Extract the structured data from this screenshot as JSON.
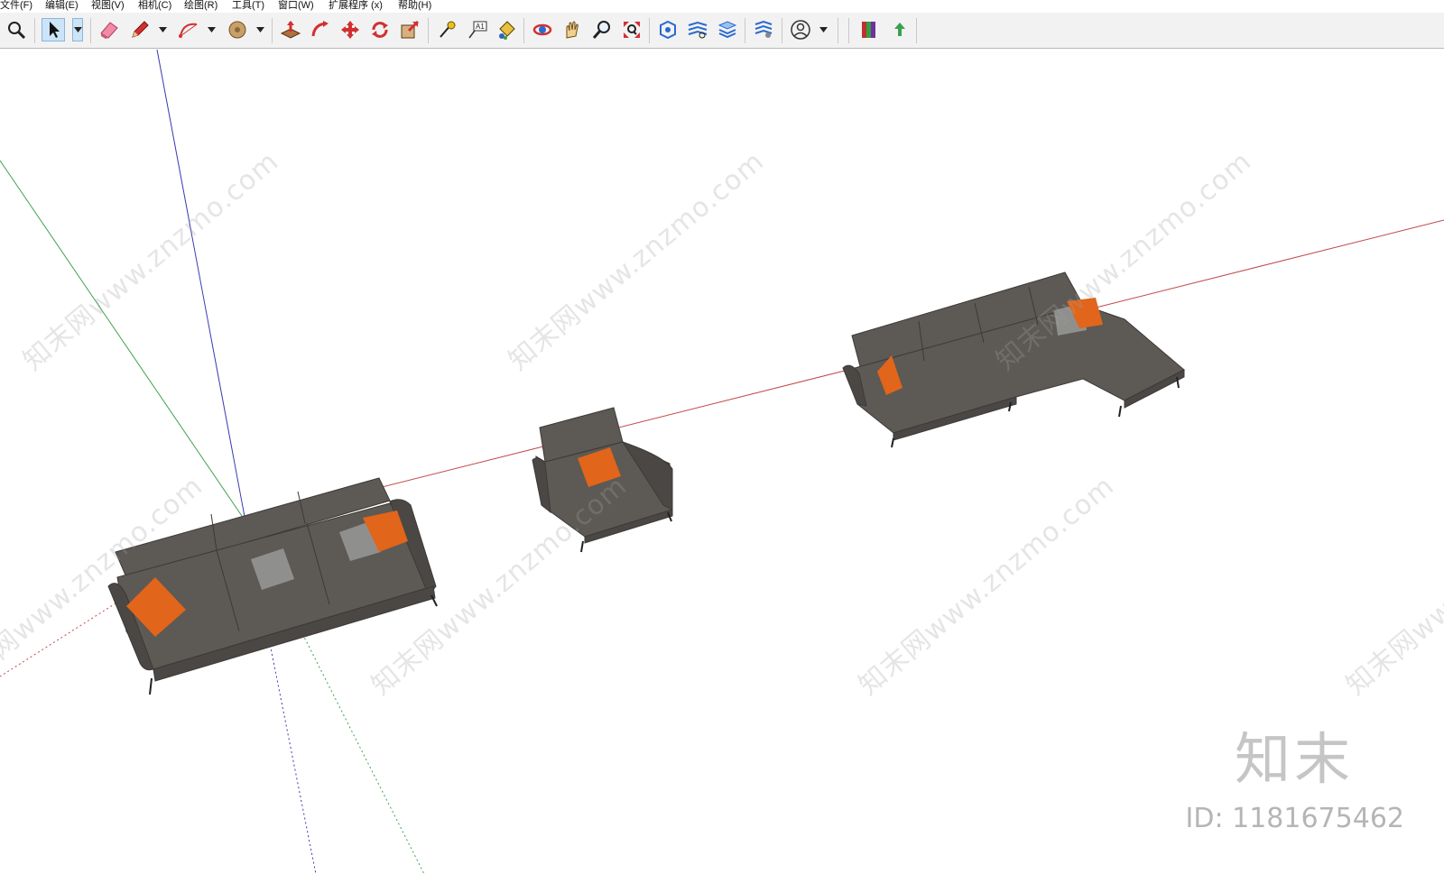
{
  "menu": [
    {
      "label": "文件(F)"
    },
    {
      "label": "编辑(E)"
    },
    {
      "label": "视图(V)"
    },
    {
      "label": "相机(C)"
    },
    {
      "label": "绘图(R)"
    },
    {
      "label": "工具(T)"
    },
    {
      "label": "窗口(W)"
    },
    {
      "label": "扩展程序 (x)"
    },
    {
      "label": "帮助(H)"
    }
  ],
  "toolbar": {
    "tools": [
      {
        "icon": "zoom-icon"
      },
      {
        "icon": "select-arrow-icon",
        "active": true
      },
      {
        "icon": "eraser-icon"
      },
      {
        "icon": "pencil-icon"
      },
      {
        "icon": "arc-icon"
      },
      {
        "icon": "shape-icon"
      },
      {
        "icon": "push-pull-icon"
      },
      {
        "icon": "follow-me-icon"
      },
      {
        "icon": "move-icon"
      },
      {
        "icon": "rotate-icon"
      },
      {
        "icon": "scale-icon"
      },
      {
        "icon": "tape-measure-icon"
      },
      {
        "icon": "text-icon",
        "text": "A1"
      },
      {
        "icon": "paint-bucket-icon"
      },
      {
        "icon": "orbit-icon"
      },
      {
        "icon": "pan-icon"
      },
      {
        "icon": "zoom-window-icon"
      },
      {
        "icon": "zoom-extents-icon"
      },
      {
        "icon": "warehouse-icon"
      },
      {
        "icon": "extension-icon"
      },
      {
        "icon": "layers-icon"
      },
      {
        "icon": "extension-settings-icon"
      },
      {
        "icon": "account-icon"
      },
      {
        "icon": "style-icon"
      },
      {
        "icon": "upload-icon"
      }
    ]
  },
  "colors": {
    "sofa": "#5d5955",
    "sofa_dark": "#4a4744",
    "pillow_orange": "#e1651a",
    "pillow_gray": "#8f908d",
    "axis_red": "#c0494a",
    "axis_green": "#3fa34a",
    "axis_blue": "#3a3ab0"
  },
  "watermark": {
    "text": "知末网www.znzmo.com",
    "logo": "知末",
    "id_label": "ID: 1181675462"
  }
}
